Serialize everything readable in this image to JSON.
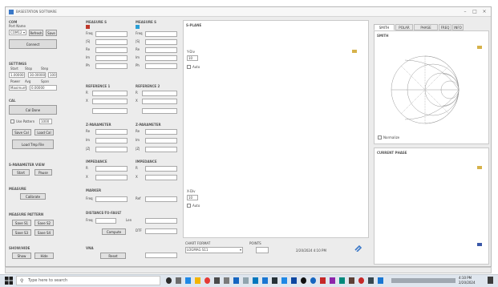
{
  "window": {
    "title": "BASESTATION SOFTWARE",
    "controls": [
      "–",
      "□",
      "×"
    ]
  },
  "com": {
    "header": "COM",
    "port_label": "Port Name",
    "port_value": "COM12",
    "refresh": "Refresh",
    "save": "Save",
    "connect": "Connect"
  },
  "settings": {
    "header": "SETTINGS",
    "start_label": "Start",
    "stop_label": "Stop",
    "step_label": "Step",
    "start_value": "1.00000",
    "stop_value": "30.00000",
    "step_value": "100",
    "row2_labels": [
      "Power",
      "Avg",
      "Span"
    ],
    "row2_value_a": "Maximum",
    "row2_value_b": "0.00000"
  },
  "cal": {
    "header": "CAL",
    "cal_button": "Cal Done",
    "use_pattern_label": "Use Pattern",
    "pattern_value": "1000",
    "btn_a": "Save Cal",
    "btn_b": "Load Cal",
    "load_btn": "Load Tmp File"
  },
  "sections": {
    "s1": {
      "header": "S-PARAMETER VIEW",
      "btn_a": "Start",
      "btn_b": "Pause"
    },
    "s2": {
      "header": "MEASURE",
      "btn_a": "Calibrate"
    },
    "s3": {
      "header": "MEASURE PATTERN",
      "btn_a": "Save S1",
      "btn_b": "Save S2",
      "btn_c": "Save S3",
      "btn_d": "Save S4"
    },
    "s4": {
      "header": "SHOW/HIDE",
      "btn_a": "Show",
      "btn_b": "Hide"
    }
  },
  "col2": {
    "g1": {
      "header": "MEASURE S",
      "rows": [
        "Freq",
        "|S|",
        "Re",
        "Im",
        "Ph"
      ]
    },
    "g2": {
      "header": "MEASURE S",
      "rows": [
        "Freq",
        "|S|",
        "Re",
        "Im",
        "Ph"
      ]
    },
    "g3": {
      "header": "REFERENCE 1",
      "rows": [
        "R",
        "X"
      ]
    },
    "g4": {
      "header": "REFERENCE 2",
      "rows": [
        "R",
        "X"
      ]
    },
    "g5": {
      "header": "Z-PARAMETER",
      "rows": [
        "Re",
        "Im",
        "|Z|"
      ]
    },
    "g6": {
      "header": "Z-PARAMETER",
      "rows": [
        "Re",
        "Im",
        "|Z|"
      ]
    },
    "g7": {
      "header": "IMPEDANCE",
      "rows": [
        "R",
        "X"
      ]
    },
    "g8": {
      "header": "IMPEDANCE",
      "rows": [
        "R",
        "X"
      ]
    },
    "g9": {
      "header": "MARKER",
      "freq_label": "Freq",
      "ref_label": "Ref"
    },
    "g10": {
      "header": "DISTANCE-TO-FAULT",
      "row_a": "Freq",
      "row_b": "Len",
      "btn": "Compute",
      "row_c": "DTF"
    },
    "g11": {
      "header": "VNA",
      "btn": "Reset"
    }
  },
  "plot_main": {
    "header": "S-PLANE",
    "scale_top_label": "Y-Div",
    "scale_top_value": "10",
    "chk_top": "Auto",
    "scale_bot_label": "X-Div",
    "scale_bot_value": "10",
    "chk_bot": "Auto",
    "chart_format_label": "CHART FORMAT",
    "chart_format_value": "LOGMAG S11",
    "points_label": "POINTS",
    "timestamp": "2/20/2024 4:10 PM"
  },
  "right_panel": {
    "tabs": [
      "SMITH CHART",
      "POLAR",
      "PHASE ERROR",
      "FREQ",
      "INFO"
    ],
    "smith_header": "SMITH",
    "normalize_label": "Normalize",
    "lower_header": "CURRENT PHASE"
  },
  "taskbar": {
    "search_placeholder": "Type here to search",
    "clock_time": "4:10 PM",
    "clock_date": "2/20/2024"
  },
  "colors": {
    "accent": "#3a78c8",
    "marker": "#d6b24a",
    "taskbar": "#dfe6ee"
  }
}
